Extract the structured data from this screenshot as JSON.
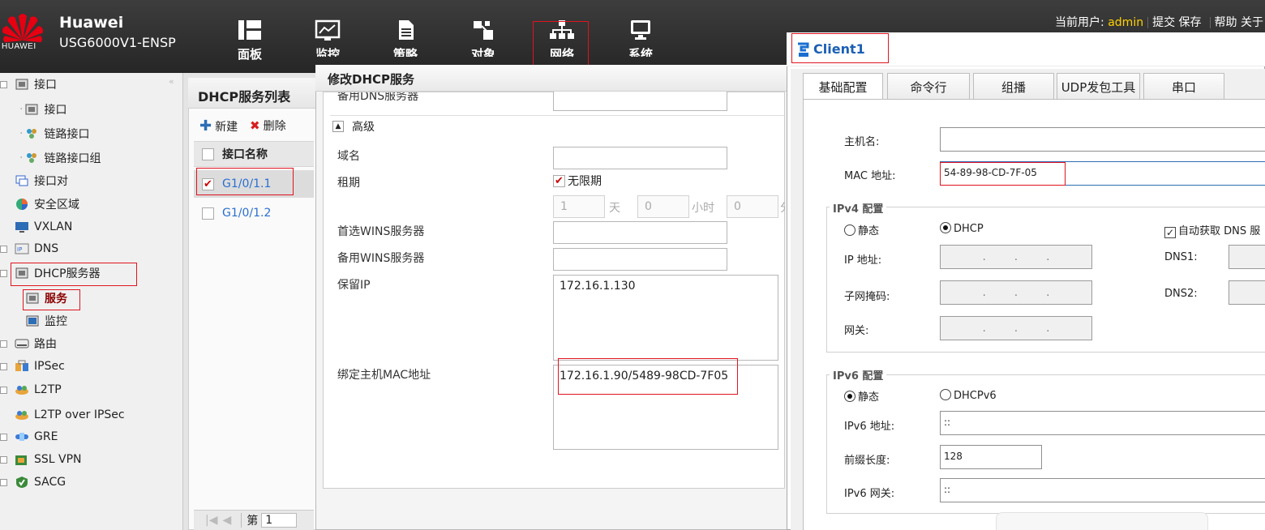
{
  "header": {
    "logo_text": "HUAWEI",
    "brand": "Huawei",
    "model": "USG6000V1-ENSP",
    "nav": [
      {
        "label": "面板",
        "icon": "dashboard-icon"
      },
      {
        "label": "监控",
        "icon": "monitor-chart-icon"
      },
      {
        "label": "策略",
        "icon": "policy-document-icon"
      },
      {
        "label": "对象",
        "icon": "object-icon"
      },
      {
        "label": "网络",
        "icon": "network-topology-icon"
      },
      {
        "label": "系统",
        "icon": "system-computer-icon"
      }
    ],
    "user_label": "当前用户:",
    "user_name": "admin",
    "links": [
      "提交",
      "保存",
      "帮助",
      "关于"
    ]
  },
  "sidebar": {
    "items": [
      {
        "label": "接口",
        "icon": "interface-icon"
      },
      {
        "label": "接口",
        "icon": "interface-icon"
      },
      {
        "label": "链路接口",
        "icon": "link-interface-icon"
      },
      {
        "label": "链路接口组",
        "icon": "link-interface-group-icon"
      },
      {
        "label": "接口对",
        "icon": "interface-pair-icon"
      },
      {
        "label": "安全区域",
        "icon": "security-zone-icon"
      },
      {
        "label": "VXLAN",
        "icon": "vxlan-icon"
      },
      {
        "label": "DNS",
        "icon": "dns-icon"
      },
      {
        "label": "DHCP服务器",
        "icon": "dhcp-server-icon"
      },
      {
        "label": "服务",
        "icon": "service-icon"
      },
      {
        "label": "监控",
        "icon": "monitor-icon"
      },
      {
        "label": "路由",
        "icon": "route-icon"
      },
      {
        "label": "IPSec",
        "icon": "ipsec-icon"
      },
      {
        "label": "L2TP",
        "icon": "l2tp-icon"
      },
      {
        "label": "L2TP over IPSec",
        "icon": "l2tp-ipsec-icon"
      },
      {
        "label": "GRE",
        "icon": "gre-icon"
      },
      {
        "label": "SSL VPN",
        "icon": "ssl-vpn-icon"
      },
      {
        "label": "SACG",
        "icon": "sacg-icon"
      }
    ]
  },
  "list": {
    "title": "DHCP服务列表",
    "new_label": "新建",
    "delete_label": "删除",
    "column": "接口名称",
    "rows": [
      {
        "name": "G1/0/1.1",
        "checked": true
      },
      {
        "name": "G1/0/1.2",
        "checked": false
      }
    ],
    "pager_label": "第",
    "pager_value": "1"
  },
  "dialog": {
    "title": "修改DHCP服务",
    "partial_label": "备用DNS服务器",
    "section": "高级",
    "domain_label": "域名",
    "lease_label": "租期",
    "unlimited_label": "无限期",
    "lease_days": "1",
    "days_unit": "天",
    "lease_hours": "0",
    "hours_unit": "小时",
    "lease_minutes": "0",
    "minutes_unit": "分",
    "wins1_label": "首选WINS服务器",
    "wins2_label": "备用WINS服务器",
    "reserved_label": "保留IP",
    "reserved_value": "172.16.1.130",
    "bind_label": "绑定主机MAC地址",
    "bind_value": "172.16.1.90/5489-98CD-7F05"
  },
  "client": {
    "title": "Client1",
    "tabs": [
      "基础配置",
      "命令行",
      "组播",
      "UDP发包工具",
      "串口"
    ],
    "hostname_label": "主机名:",
    "hostname_value": "",
    "mac_label": "MAC 地址:",
    "mac_value": "54-89-98-CD-7F-05",
    "ipv4_title": "IPv4 配置",
    "static_label": "静态",
    "dhcp_label": "DHCP",
    "auto_dns_label": "自动获取 DNS 服",
    "ip_label": "IP 地址:",
    "mask_label": "子网掩码:",
    "gw_label": "网关:",
    "dns1_label": "DNS1:",
    "dns2_label": "DNS2:",
    "ipv6_title": "IPv6 配置",
    "static6_label": "静态",
    "dhcpv6_label": "DHCPv6",
    "ipv6_label": "IPv6 地址:",
    "ipv6_value": "::",
    "prefix_label": "前缀长度:",
    "prefix_value": "128",
    "ipv6gw_label": "IPv6 网关:",
    "ipv6gw_value": "::"
  },
  "colors": {
    "highlight_border": "#e0141e",
    "link_blue": "#2a6fd0",
    "client_title": "#1a5fb4",
    "username": "#ffd200"
  }
}
